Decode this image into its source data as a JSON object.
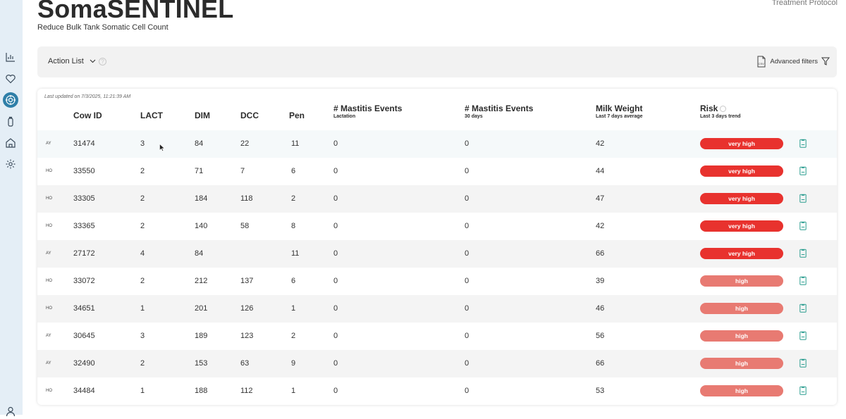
{
  "header": {
    "title": "SomaSENTINEL",
    "subtitle": "Reduce Bulk Tank Somatic Cell Count",
    "top_link": "Treatment Protocol"
  },
  "sidebar": {
    "items": [
      {
        "icon": "bar-chart-icon"
      },
      {
        "icon": "heart-icon"
      },
      {
        "icon": "target-icon",
        "active": true
      },
      {
        "icon": "bottle-icon"
      },
      {
        "icon": "barn-icon"
      },
      {
        "icon": "gear-icon"
      },
      {
        "icon": "user-icon"
      }
    ]
  },
  "toolbar": {
    "action_list_label": "Action List",
    "help_glyph": "?",
    "advanced_filters_label": "Advanced filters"
  },
  "table": {
    "last_updated": "Last updated on 7/3/2025, 11:21:39 AM",
    "headers": {
      "cow_id": "Cow ID",
      "lact": "LACT",
      "dim": "DIM",
      "dcc": "DCC",
      "pen": "Pen",
      "mastitis_lact": "# Mastitis Events",
      "mastitis_lact_sub": "Lactation",
      "mastitis_30": "# Mastitis Events",
      "mastitis_30_sub": "30 days",
      "milk_weight": "Milk Weight",
      "milk_weight_sub": "Last 7 days average",
      "risk": "Risk",
      "risk_sub": "Last 3 days trend"
    },
    "rows": [
      {
        "breed": "AY",
        "cow_id": "31474",
        "lact": "3",
        "dim": "84",
        "dcc": "22",
        "pen": "11",
        "mastitis_lact": "0",
        "mastitis_30": "0",
        "milk_weight": "42",
        "risk": "very high"
      },
      {
        "breed": "HO",
        "cow_id": "33550",
        "lact": "2",
        "dim": "71",
        "dcc": "7",
        "pen": "6",
        "mastitis_lact": "0",
        "mastitis_30": "0",
        "milk_weight": "44",
        "risk": "very high"
      },
      {
        "breed": "HO",
        "cow_id": "33305",
        "lact": "2",
        "dim": "184",
        "dcc": "118",
        "pen": "2",
        "mastitis_lact": "0",
        "mastitis_30": "0",
        "milk_weight": "47",
        "risk": "very high"
      },
      {
        "breed": "HO",
        "cow_id": "33365",
        "lact": "2",
        "dim": "140",
        "dcc": "58",
        "pen": "8",
        "mastitis_lact": "0",
        "mastitis_30": "0",
        "milk_weight": "42",
        "risk": "very high"
      },
      {
        "breed": "AY",
        "cow_id": "27172",
        "lact": "4",
        "dim": "84",
        "dcc": "",
        "pen": "11",
        "mastitis_lact": "0",
        "mastitis_30": "0",
        "milk_weight": "66",
        "risk": "very high"
      },
      {
        "breed": "HO",
        "cow_id": "33072",
        "lact": "2",
        "dim": "212",
        "dcc": "137",
        "pen": "6",
        "mastitis_lact": "0",
        "mastitis_30": "0",
        "milk_weight": "39",
        "risk": "high"
      },
      {
        "breed": "HO",
        "cow_id": "34651",
        "lact": "1",
        "dim": "201",
        "dcc": "126",
        "pen": "1",
        "mastitis_lact": "0",
        "mastitis_30": "0",
        "milk_weight": "46",
        "risk": "high"
      },
      {
        "breed": "AY",
        "cow_id": "30645",
        "lact": "3",
        "dim": "189",
        "dcc": "123",
        "pen": "2",
        "mastitis_lact": "0",
        "mastitis_30": "0",
        "milk_weight": "56",
        "risk": "high"
      },
      {
        "breed": "AY",
        "cow_id": "32490",
        "lact": "2",
        "dim": "153",
        "dcc": "63",
        "pen": "9",
        "mastitis_lact": "0",
        "mastitis_30": "0",
        "milk_weight": "66",
        "risk": "high"
      },
      {
        "breed": "HO",
        "cow_id": "34484",
        "lact": "1",
        "dim": "188",
        "dcc": "112",
        "pen": "1",
        "mastitis_lact": "0",
        "mastitis_30": "0",
        "milk_weight": "53",
        "risk": "high"
      }
    ]
  },
  "colors": {
    "very_high": "#e8322e",
    "high": "#e87a72",
    "sidebar_bg": "#e4eef6",
    "active_icon_bg": "#2f7fa8"
  }
}
